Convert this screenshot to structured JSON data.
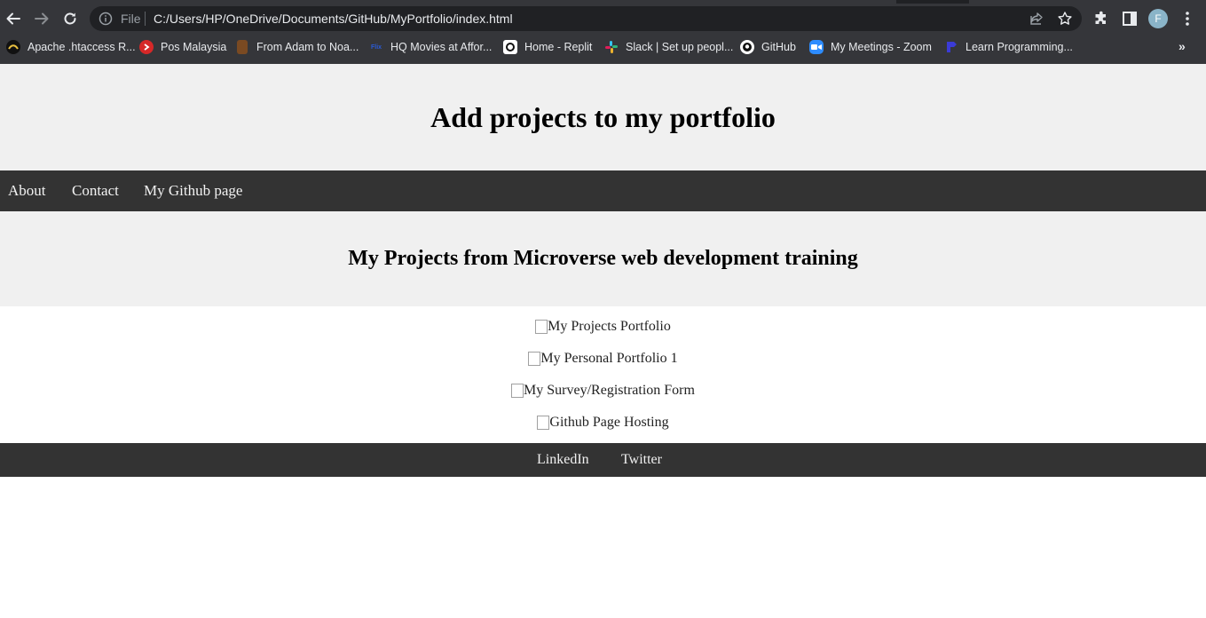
{
  "browser": {
    "address_scheme": "File",
    "url": "C:/Users/HP/OneDrive/Documents/GitHub/MyPortfolio/index.html",
    "profile_initial": "F",
    "bookmarks": [
      {
        "label": "Apache .htaccess R...",
        "icon": "apache-icon"
      },
      {
        "label": "Pos Malaysia",
        "icon": "pos-malaysia-icon"
      },
      {
        "label": "From Adam to Noa...",
        "icon": "book-icon"
      },
      {
        "label": "HQ Movies at Affor...",
        "icon": "movies-icon"
      },
      {
        "label": "Home - Replit",
        "icon": "replit-icon"
      },
      {
        "label": "Slack | Set up peopl...",
        "icon": "slack-icon"
      },
      {
        "label": "GitHub",
        "icon": "github-icon"
      },
      {
        "label": "My Meetings - Zoom",
        "icon": "zoom-icon"
      },
      {
        "label": "Learn Programming...",
        "icon": "programming-icon"
      }
    ],
    "bookmarks_overflow": "»"
  },
  "page": {
    "title": "Add projects to my portfolio",
    "nav": [
      "About",
      "Contact",
      "My Github page"
    ],
    "section_heading": "My Projects from Microverse web development training",
    "projects": [
      "My Projects Portfolio",
      "My Personal Portfolio 1",
      "My Survey/Registration Form",
      "Github Page Hosting"
    ],
    "footer_links": [
      "LinkedIn",
      "Twitter"
    ]
  },
  "colors": {
    "chrome_bg": "#35363a",
    "omnibox_bg": "#202124",
    "header_bg": "#f0f0f0",
    "nav_bg": "#333333",
    "nav_text": "#f2f2f2"
  }
}
